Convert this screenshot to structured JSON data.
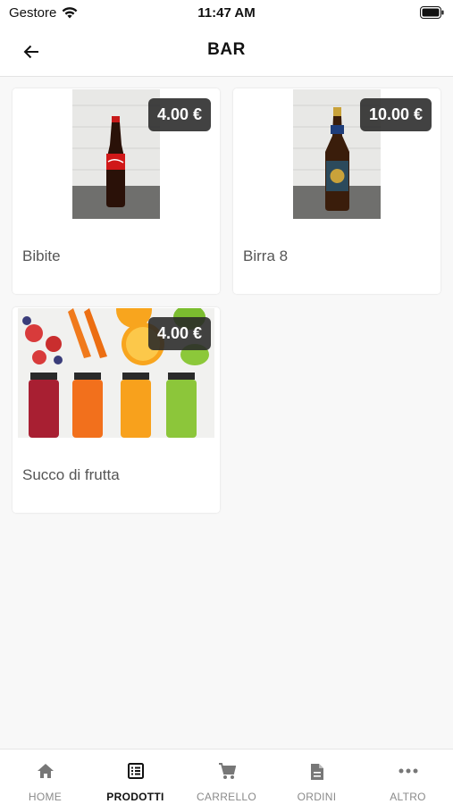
{
  "status_bar": {
    "carrier": "Gestore",
    "time": "11:47 AM"
  },
  "header": {
    "title": "BAR",
    "back_icon": "arrow-left-icon"
  },
  "products": [
    {
      "name": "Bibite",
      "price": "4.00 €",
      "image": "cola-bottle"
    },
    {
      "name": "Birra 8",
      "price": "10.00 €",
      "image": "beer-bottle"
    },
    {
      "name": "Succo di frutta",
      "price": "4.00 €",
      "image": "juice-bottles"
    }
  ],
  "tabs": [
    {
      "label": "HOME",
      "icon": "home-icon",
      "active": false
    },
    {
      "label": "PRODOTTI",
      "icon": "list-icon",
      "active": true
    },
    {
      "label": "CARRELLO",
      "icon": "cart-icon",
      "active": false
    },
    {
      "label": "ORDINI",
      "icon": "document-icon",
      "active": false
    },
    {
      "label": "ALTRO",
      "icon": "more-icon",
      "active": false
    }
  ],
  "colors": {
    "background": "#f8f8f8",
    "price_badge": "#282828",
    "active_tab": "#111111",
    "inactive_tab": "#8a8a8a"
  }
}
